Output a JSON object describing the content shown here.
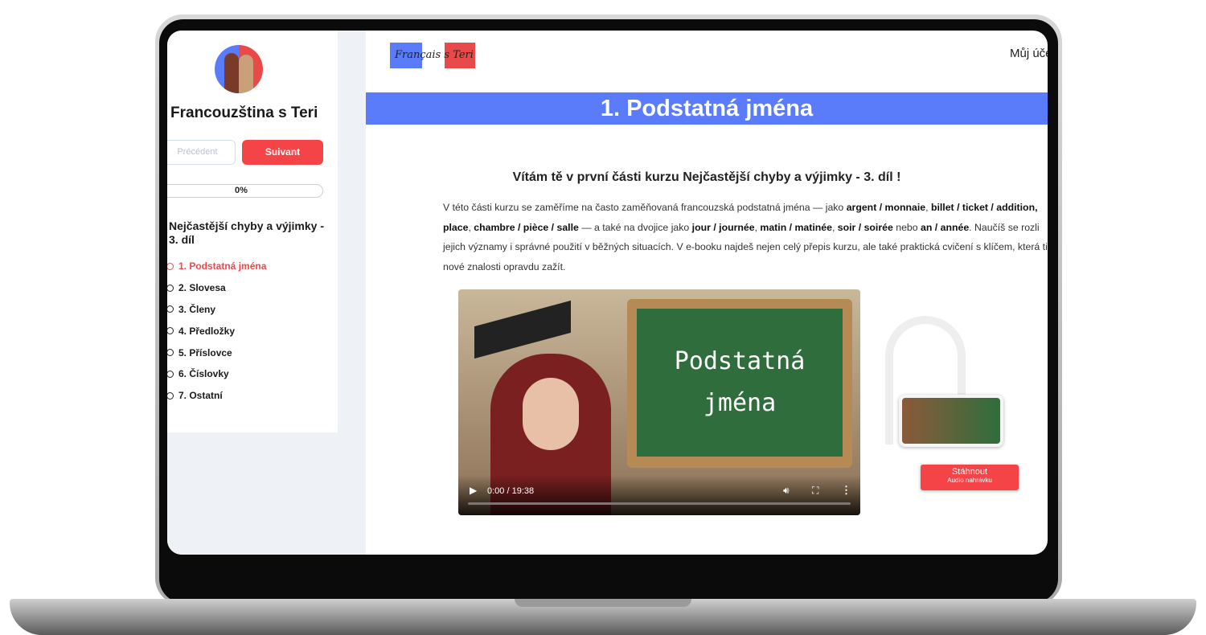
{
  "sidebar": {
    "site_name": "Francouzština s Teri",
    "prev_label": "Précédent",
    "next_label": "Suivant",
    "progress": "0%",
    "course_title": "Nejčastější chyby a výjimky - 3. díl",
    "lessons": [
      {
        "label": "1. Podstatná jména"
      },
      {
        "label": "2. Slovesa"
      },
      {
        "label": "3. Členy"
      },
      {
        "label": "4. Předložky"
      },
      {
        "label": "5. Příslovce"
      },
      {
        "label": "6. Číslovky"
      },
      {
        "label": "7. Ostatní"
      }
    ]
  },
  "header": {
    "logo_text": "Français s Teri",
    "account": "Můj úče"
  },
  "main": {
    "title": "1. Podstatná jména",
    "welcome": "Vítám tě v první části kurzu Nejčastější chyby a výjimky - 3. díl !",
    "intro": {
      "l1a": "V této části kurzu se zaměříme na často zaměňovaná francouzská podstatná jména — jako ",
      "l1b": "argent / monnaie",
      "l1c": ", ",
      "l1d": "billet / ticket / addition",
      "l2a": "place",
      "l2b": ", ",
      "l2c": "chambre / pièce / salle",
      "l2d": " — a také na dvojice jako ",
      "l2e": "jour / journée",
      "l2f": ", ",
      "l2g": "matin / matinée",
      "l2h": ", ",
      "l2i": "soir / soirée",
      "l2j": " nebo ",
      "l2k": "an / année",
      "l2l": ". Naučíš se rozli",
      "l3": "jejich významy i správné použití v běžných situacích. V e-booku najdeš nejen celý přepis kurzu, ale také praktická cvičení s klíčem, která ti",
      "l4": "nové znalosti opravdu zažít."
    },
    "video": {
      "board_line1": "Podstatná",
      "board_line2": "jména",
      "time": "0:00 / 19:38",
      "progress": 0
    },
    "download": {
      "label": "Stáhnout",
      "sublabel": "Audio nahrávku"
    }
  }
}
